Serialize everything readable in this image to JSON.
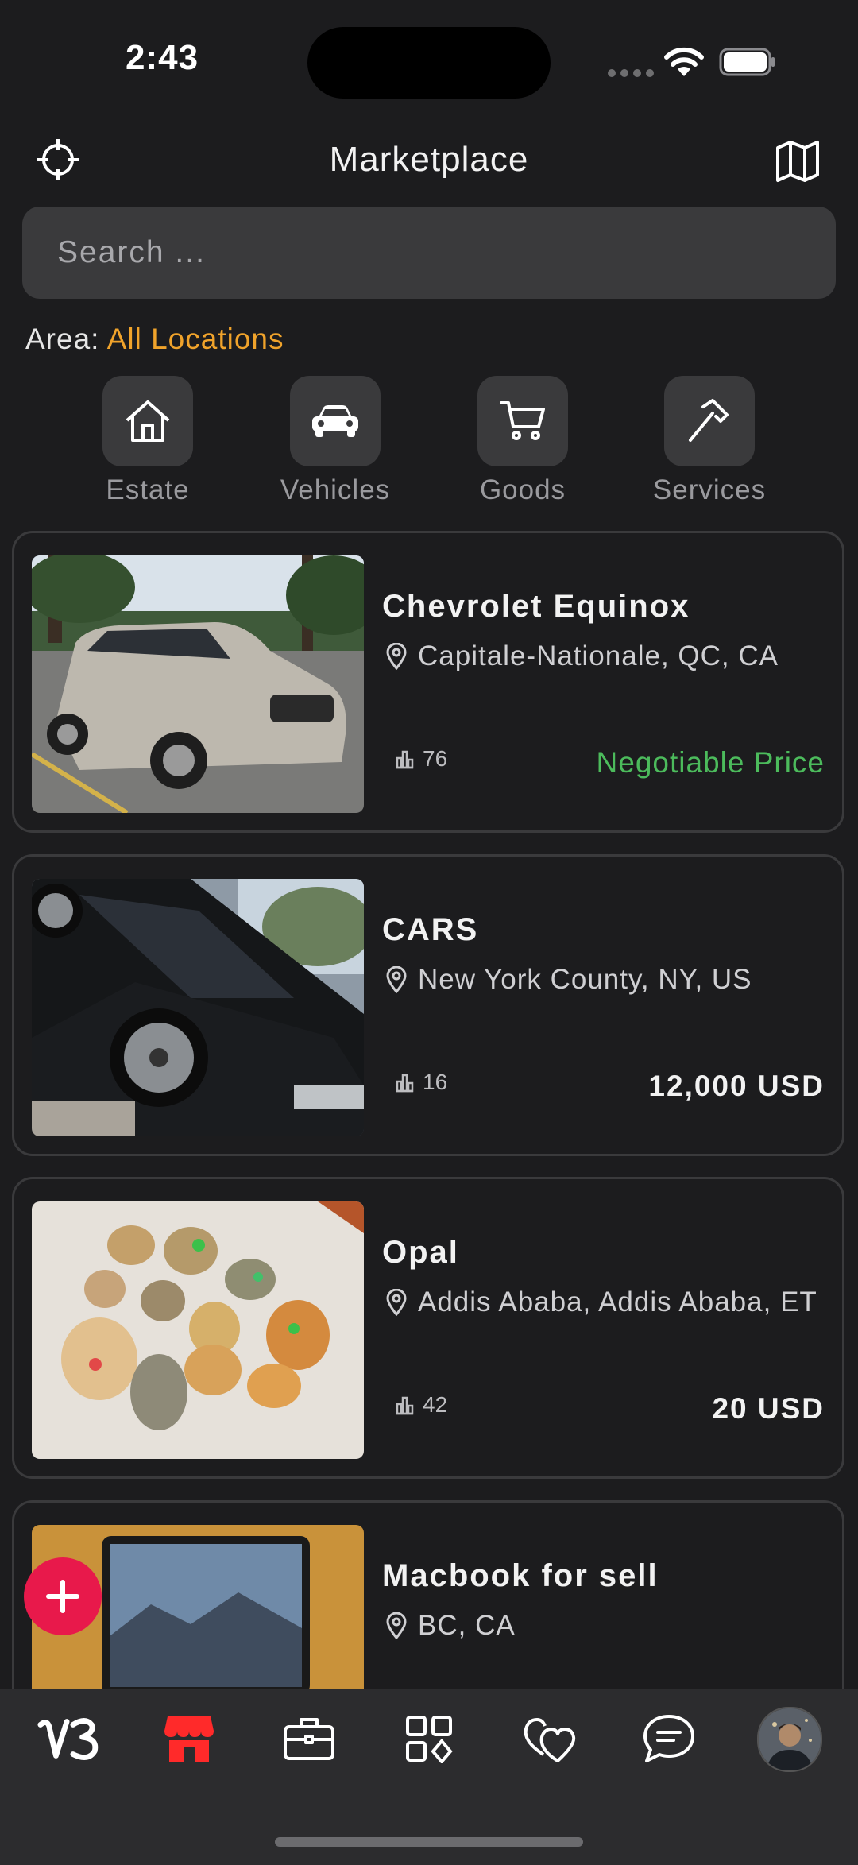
{
  "status_bar": {
    "time": "2:43"
  },
  "header": {
    "title": "Marketplace",
    "left_icon": "crosshair-icon",
    "right_icon": "map-icon"
  },
  "search": {
    "placeholder": "Search ..."
  },
  "area": {
    "label": "Area:",
    "value": "All Locations"
  },
  "categories": [
    {
      "label": "Estate",
      "icon": "house-icon"
    },
    {
      "label": "Vehicles",
      "icon": "car-icon"
    },
    {
      "label": "Goods",
      "icon": "cart-icon"
    },
    {
      "label": "Services",
      "icon": "hammer-icon"
    }
  ],
  "listings": [
    {
      "title": "Chevrolet Equinox",
      "location": "Capitale-Nationale, QC, CA",
      "views": "76",
      "price": "Negotiable Price"
    },
    {
      "title": "CARS",
      "location": "New York County, NY, US",
      "views": "16",
      "price": "12,000 USD"
    },
    {
      "title": "Opal",
      "location": "Addis Ababa, Addis Ababa, ET",
      "views": "42",
      "price": "20 USD"
    },
    {
      "title": "Macbook for sell",
      "location": "BC, CA",
      "views": "",
      "price": ""
    }
  ],
  "tabs": [
    {
      "icon": "app-logo-icon"
    },
    {
      "icon": "store-icon",
      "active": true
    },
    {
      "icon": "briefcase-icon"
    },
    {
      "icon": "apps-grid-icon"
    },
    {
      "icon": "hearts-icon"
    },
    {
      "icon": "chat-icon"
    },
    {
      "icon": "avatar"
    }
  ],
  "colors": {
    "background": "#1c1c1e",
    "accent_orange": "#f0a32b",
    "accent_red": "#e8194b",
    "negotiable_green": "#4cbb5c"
  }
}
